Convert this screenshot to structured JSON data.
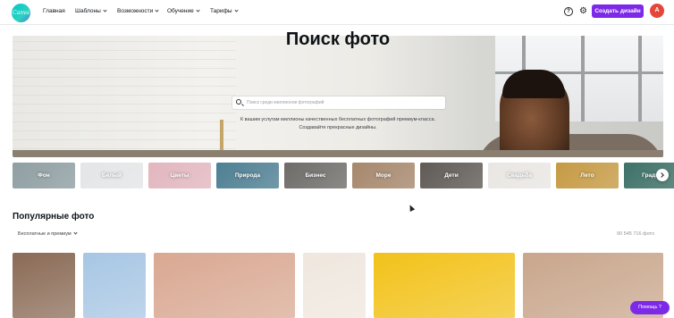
{
  "header": {
    "logo_text": "Canva",
    "nav": [
      {
        "label": "Главная",
        "chevron": false
      },
      {
        "label": "Шаблоны",
        "chevron": true
      },
      {
        "label": "Возможности",
        "chevron": true
      },
      {
        "label": "Обучение",
        "chevron": true
      },
      {
        "label": "Тарифы",
        "chevron": true
      }
    ],
    "help_icon": "?",
    "gear_icon": "⚙",
    "create_button": "Создать дизайн",
    "avatar_letter": "A"
  },
  "hero": {
    "title": "Поиск фото",
    "search_placeholder": "Поиск среди миллионов фотографий",
    "subtitle_line1": "К вашим услугам миллионы качественных бесплатных фотографий премиум-класса.",
    "subtitle_line2": "Создавайте прекрасные дизайны."
  },
  "categories": [
    {
      "label": "Фон",
      "color": "#8e9ea2"
    },
    {
      "label": "Белый",
      "color": "#e4e5e7"
    },
    {
      "label": "Цветы",
      "color": "#e2b6bf"
    },
    {
      "label": "Природа",
      "color": "#4e7f93"
    },
    {
      "label": "Бизнес",
      "color": "#6d6c69"
    },
    {
      "label": "Море",
      "color": "#a6876c"
    },
    {
      "label": "Дети",
      "color": "#5f5a55"
    },
    {
      "label": "Свадьба",
      "color": "#e9e6e3"
    },
    {
      "label": "Лето",
      "color": "#c59a44"
    },
    {
      "label": "Градиент",
      "color": "#3e7168"
    }
  ],
  "popular": {
    "title": "Популярные фото",
    "filter_label": "Бесплатные и премиум",
    "count": "90 545 716 фото",
    "photos": [
      {
        "color": "#8a6a55"
      },
      {
        "color": "#a7c6e4"
      },
      {
        "color": "#d9a892"
      },
      {
        "color": "#efe7de"
      },
      {
        "color": "#f2c21a"
      },
      {
        "color": "#c9a68c"
      }
    ]
  },
  "help_button": "Помощь ?"
}
